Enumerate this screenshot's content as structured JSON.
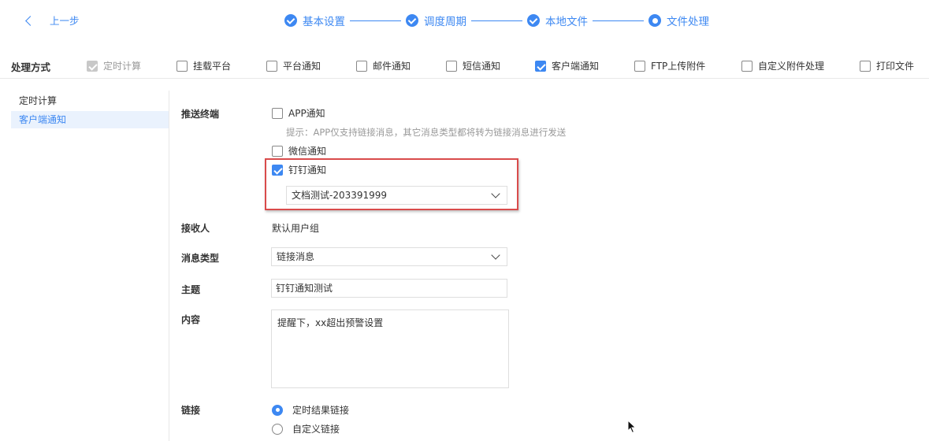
{
  "header": {
    "back_label": "上一步",
    "steps": [
      {
        "label": "基本设置",
        "state": "done"
      },
      {
        "label": "调度周期",
        "state": "done"
      },
      {
        "label": "本地文件",
        "state": "done"
      },
      {
        "label": "文件处理",
        "state": "current"
      }
    ]
  },
  "modes": {
    "label": "处理方式",
    "options": [
      {
        "label": "定时计算",
        "checked": true,
        "disabled": true
      },
      {
        "label": "挂载平台",
        "checked": false
      },
      {
        "label": "平台通知",
        "checked": false
      },
      {
        "label": "邮件通知",
        "checked": false
      },
      {
        "label": "短信通知",
        "checked": false
      },
      {
        "label": "客户端通知",
        "checked": true
      },
      {
        "label": "FTP上传附件",
        "checked": false
      },
      {
        "label": "自定义附件处理",
        "checked": false
      },
      {
        "label": "打印文件",
        "checked": false
      }
    ]
  },
  "sidebar": {
    "items": [
      {
        "label": "定时计算",
        "active": false
      },
      {
        "label": "客户端通知",
        "active": true
      }
    ]
  },
  "form": {
    "push_label": "推送终端",
    "app_label": "APP通知",
    "app_checked": false,
    "app_hint": "提示：APP仅支持链接消息，其它消息类型都将转为链接消息进行发送",
    "wechat_label": "微信通知",
    "wechat_checked": false,
    "dingtalk_label": "钉钉通知",
    "dingtalk_checked": true,
    "dingtalk_target": "文档测试-203391999",
    "receiver_label": "接收人",
    "receiver_value": "默认用户组",
    "msgtype_label": "消息类型",
    "msgtype_value": "链接消息",
    "subject_label": "主题",
    "subject_value": "钉钉通知测试",
    "content_label": "内容",
    "content_value": "提醒下，xx超出预警设置",
    "link_label": "链接",
    "link_options": [
      {
        "label": "定时结果链接",
        "selected": true
      },
      {
        "label": "自定义链接",
        "selected": false
      }
    ]
  },
  "colors": {
    "accent": "#3d88f2",
    "highlight_box": "#d94b4b"
  },
  "icons": [
    "chevron-left-icon",
    "check-circle-icon",
    "radio-dot-icon",
    "chevron-down-icon",
    "mouse-cursor-icon"
  ]
}
